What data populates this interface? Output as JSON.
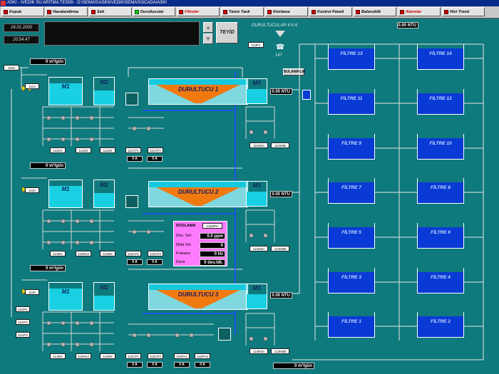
{
  "window": {
    "title": "ASKİ - İVEDİK SU ARITMA TESİSİ - D:\\SEMAS\\ASKİ\\İVEDİK\\SEMAS\\SCADA\\ASKİ"
  },
  "nav": [
    {
      "label": "Kopuk",
      "led": "red",
      "text_color": "black"
    },
    {
      "label": "Havalandirma",
      "led": "red",
      "text_color": "black"
    },
    {
      "label": "Salt",
      "led": "red",
      "text_color": "black"
    },
    {
      "label": "Durultucular",
      "led": "green",
      "text_color": "black"
    },
    {
      "label": "Filtreler",
      "led": "red",
      "text_color": "red"
    },
    {
      "label": "Tatsiz Tank",
      "led": "red",
      "text_color": "black"
    },
    {
      "label": "Klorlama",
      "led": "red",
      "text_color": "black"
    },
    {
      "label": "Kontrol Paneli",
      "led": "red",
      "text_color": "black"
    },
    {
      "label": "Balansklik",
      "led": "red",
      "text_color": "black"
    },
    {
      "label": "Alarmlar",
      "led": "red",
      "text_color": "red"
    },
    {
      "label": "Hist Trend",
      "led": "red",
      "text_color": "black"
    }
  ],
  "datetime": {
    "date": "24.01.2000",
    "time": "20:54:47"
  },
  "controls": {
    "up_arrow": "▲",
    "down_arrow": "▼",
    "confirm": "TEYİD"
  },
  "header": {
    "title": "DURULTUCULAR 4-5-6",
    "ntu_top": "0.00 NTU",
    "tag_top": "113P1",
    "phone_num": "147"
  },
  "bulanik": "BULANIKLIK",
  "lines": [
    {
      "flow": "0 m³/gün",
      "valve_tag": "1113",
      "mix1": "M1",
      "mix2": "M2",
      "clarifier": "DURULTUCU 1",
      "m3": "M3",
      "ntu": "0.00 NTU",
      "motors": [
        "111M1",
        "111M2",
        "111M2"
      ],
      "cp": [
        "111CP1",
        "111CP2"
      ],
      "amps": [
        "0 A",
        "0 A"
      ],
      "m3tags": [
        "111M3A",
        "111M3B"
      ]
    },
    {
      "flow": "0 m³/gün",
      "valve_tag": "1120",
      "mix1": "M1",
      "mix2": "M2",
      "clarifier": "DURULTUCU 2",
      "m3": "M3",
      "ntu": "0.00 NTU",
      "motors": [
        "113M1",
        "113M12",
        "113M2"
      ],
      "cp": [
        "112CP1",
        "112CP2"
      ],
      "amps": [
        "0 A",
        "0 A"
      ],
      "m3tags": [
        "112M3A",
        "112M3B"
      ]
    },
    {
      "flow": "0 m³/gün",
      "valve_tag": "1130",
      "mix1": "M1",
      "mix2": "M2",
      "clarifier": "DURULTUCU 3",
      "m3": "M3",
      "ntu": "0.00 NTU",
      "motors": [
        "113M1",
        "113M12",
        "113M2"
      ],
      "cp": [
        "113CP1",
        "113CP2",
        "11DPA1",
        "11DPA2"
      ],
      "amps": [
        "0 A",
        "0 A",
        "0 A",
        "0 A"
      ],
      "m3tags": [
        "113M3A",
        "113M3B"
      ]
    }
  ],
  "left_tags": {
    "top": "1020",
    "misc": [
      "11GP1",
      "11GP2",
      "11GP3"
    ]
  },
  "dosing": {
    "title": "DOZLAMA",
    "tag": "11DZPH",
    "rows": [
      {
        "label": "Doz. Set",
        "value": "0.0 ppm"
      },
      {
        "label": "Debi Ort.",
        "value": "0"
      },
      {
        "label": "Frekans",
        "value": "0 Hz"
      },
      {
        "label": "Devir",
        "value": "0 dev./dk."
      }
    ]
  },
  "filters": [
    {
      "name": "FİLTRE 13"
    },
    {
      "name": "FİLTRE 14"
    },
    {
      "name": "FİLTRE 11"
    },
    {
      "name": "FİLTRE 12"
    },
    {
      "name": "FİLTRE 9"
    },
    {
      "name": "FİLTRE 10"
    },
    {
      "name": "FİLTRE 7"
    },
    {
      "name": "FİLTRE 8"
    },
    {
      "name": "FİLTRE 5"
    },
    {
      "name": "FİLTRE 6"
    },
    {
      "name": "FİLTRE 3"
    },
    {
      "name": "FİLTRE 4"
    },
    {
      "name": "FİLTRE 1"
    },
    {
      "name": "FİLTRE 2"
    }
  ],
  "bottom_flow": "0 m³/gün",
  "colors": {
    "background": "#0e7a7d",
    "water": "#18d0e2",
    "sludge": "#f07a10",
    "filter_water": "#0a3ad6",
    "dosing_panel": "#ff7aff"
  }
}
